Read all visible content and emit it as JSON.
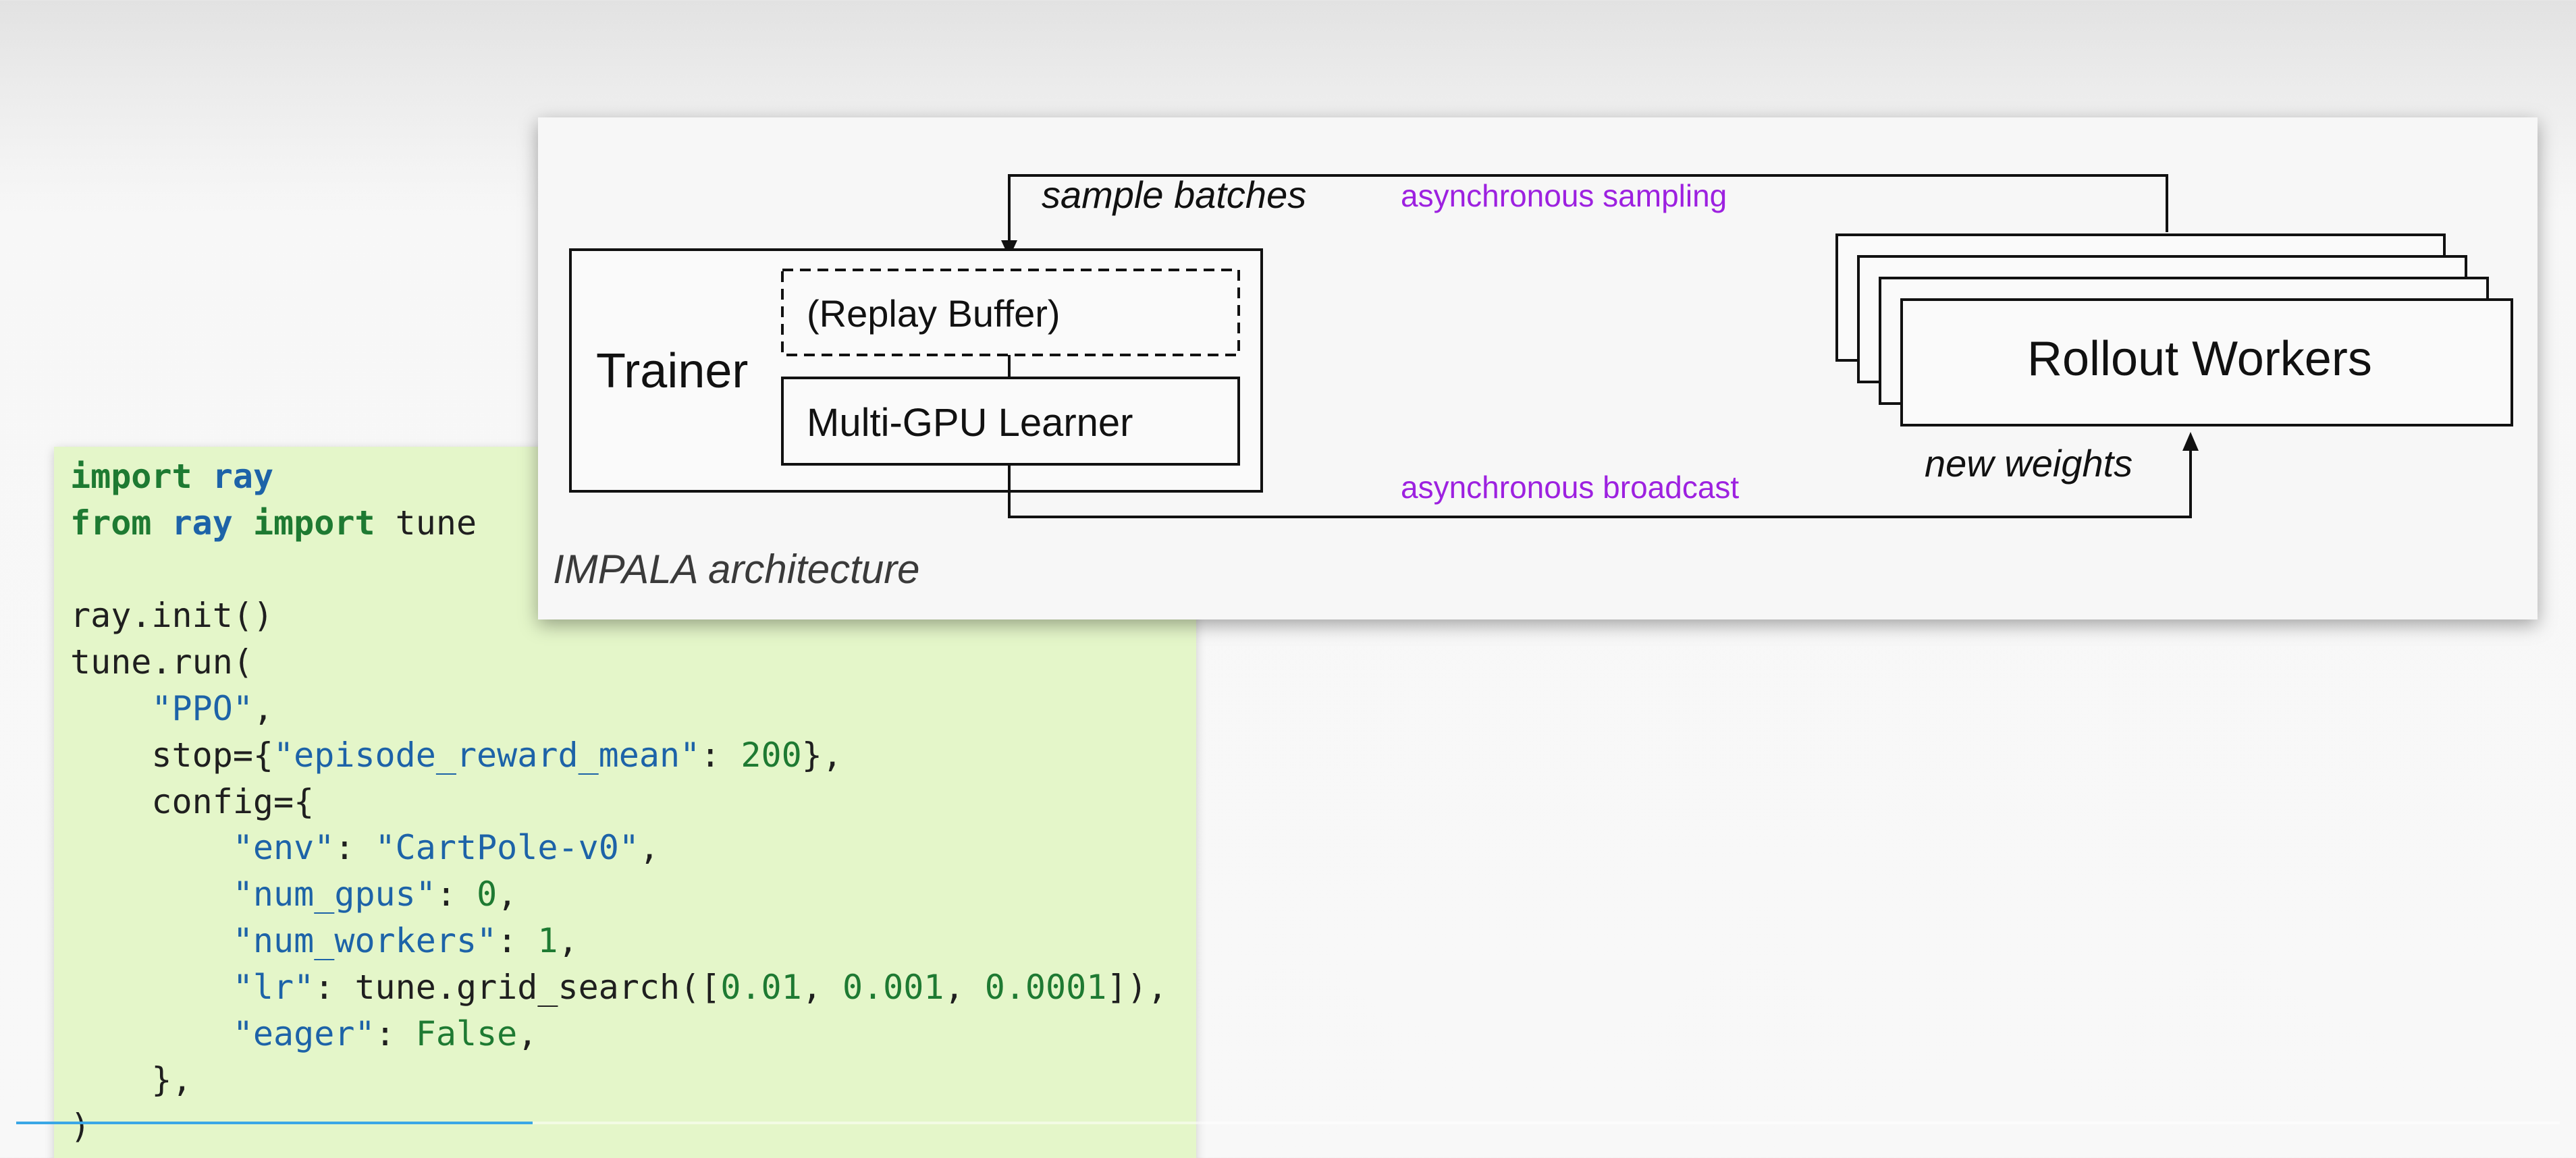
{
  "code": {
    "lines": [
      [
        {
          "t": "import",
          "c": "kw"
        },
        {
          "t": " "
        },
        {
          "t": "ray",
          "c": "mod"
        }
      ],
      [
        {
          "t": "from",
          "c": "kw"
        },
        {
          "t": " "
        },
        {
          "t": "ray",
          "c": "mod"
        },
        {
          "t": " "
        },
        {
          "t": "import",
          "c": "kw"
        },
        {
          "t": " tune"
        }
      ],
      [],
      [
        {
          "t": "ray.init()"
        }
      ],
      [
        {
          "t": "tune.run("
        }
      ],
      [
        {
          "t": "    "
        },
        {
          "t": "\"PPO\"",
          "c": "str"
        },
        {
          "t": ","
        }
      ],
      [
        {
          "t": "    stop={"
        },
        {
          "t": "\"episode_reward_mean\"",
          "c": "str"
        },
        {
          "t": ": "
        },
        {
          "t": "200",
          "c": "num"
        },
        {
          "t": "},"
        }
      ],
      [
        {
          "t": "    config={"
        }
      ],
      [
        {
          "t": "        "
        },
        {
          "t": "\"env\"",
          "c": "str"
        },
        {
          "t": ": "
        },
        {
          "t": "\"CartPole-v0\"",
          "c": "str"
        },
        {
          "t": ","
        }
      ],
      [
        {
          "t": "        "
        },
        {
          "t": "\"num_gpus\"",
          "c": "str"
        },
        {
          "t": ": "
        },
        {
          "t": "0",
          "c": "num"
        },
        {
          "t": ","
        }
      ],
      [
        {
          "t": "        "
        },
        {
          "t": "\"num_workers\"",
          "c": "str"
        },
        {
          "t": ": "
        },
        {
          "t": "1",
          "c": "num"
        },
        {
          "t": ","
        }
      ],
      [
        {
          "t": "        "
        },
        {
          "t": "\"lr\"",
          "c": "str"
        },
        {
          "t": ": tune.grid_search(["
        },
        {
          "t": "0.01",
          "c": "num"
        },
        {
          "t": ", "
        },
        {
          "t": "0.001",
          "c": "num"
        },
        {
          "t": ", "
        },
        {
          "t": "0.0001",
          "c": "num"
        },
        {
          "t": "]),"
        }
      ],
      [
        {
          "t": "        "
        },
        {
          "t": "\"eager\"",
          "c": "str"
        },
        {
          "t": ": "
        },
        {
          "t": "False",
          "c": "num"
        },
        {
          "t": ","
        }
      ],
      [
        {
          "t": "    },"
        }
      ],
      [
        {
          "t": ")"
        }
      ]
    ]
  },
  "diagram": {
    "sample_batches_label": "sample batches",
    "async_sampling_label": "asynchronous sampling",
    "trainer_label": "Trainer",
    "replay_buffer_label": "(Replay Buffer)",
    "learner_label": "Multi-GPU Learner",
    "rollout_workers_label": "Rollout Workers",
    "new_weights_label": "new weights",
    "async_broadcast_label": "asynchronous broadcast",
    "caption": "IMPALA architecture",
    "annotation_color": "#9d21e0"
  },
  "video": {
    "progress_fraction": 0.203
  }
}
